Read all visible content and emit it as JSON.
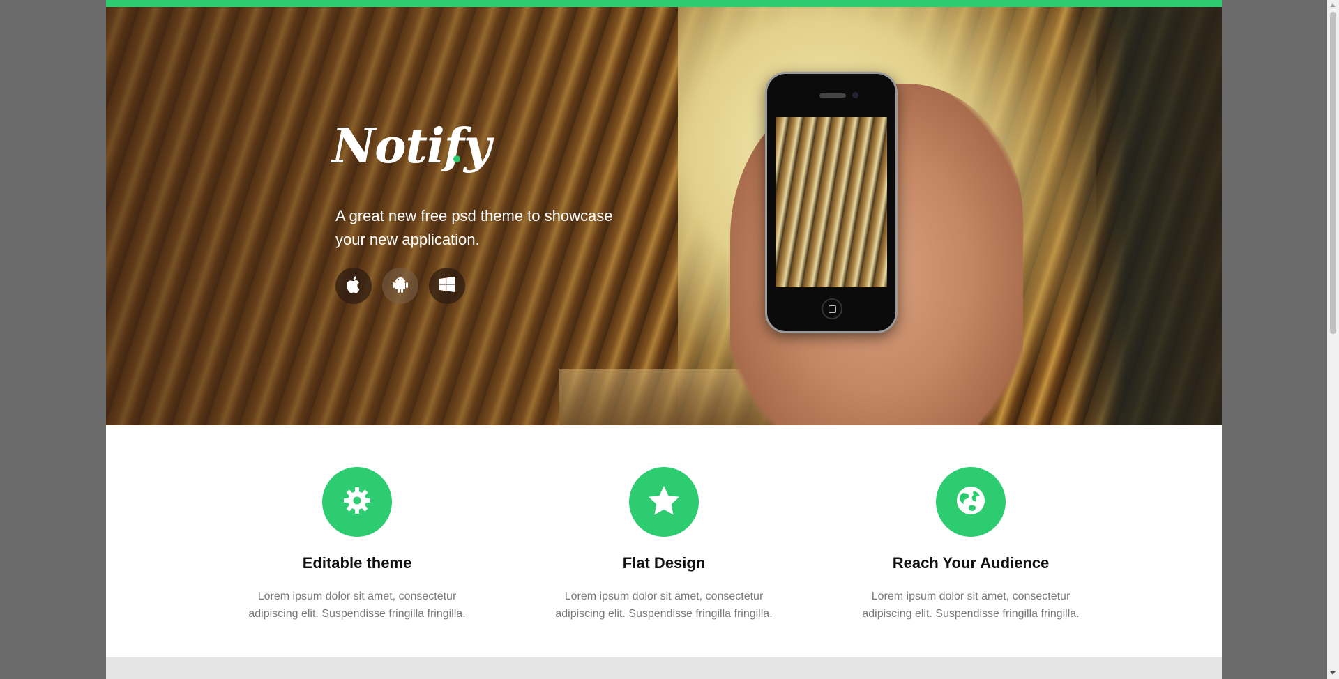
{
  "brand": {
    "name": "Notify",
    "accent_color": "#2ecc71"
  },
  "hero": {
    "tagline": "A great new free psd theme to showcase your new application.",
    "store_buttons": [
      {
        "icon": "apple-icon"
      },
      {
        "icon": "android-icon"
      },
      {
        "icon": "windows-icon"
      }
    ]
  },
  "features": [
    {
      "icon": "gear-icon",
      "title": "Editable theme",
      "text": "Lorem ipsum dolor sit amet, consectetur adipiscing elit. Suspendisse fringilla fringilla."
    },
    {
      "icon": "star-icon",
      "title": "Flat Design",
      "text": "Lorem ipsum dolor sit amet, consectetur adipiscing elit. Suspendisse fringilla fringilla."
    },
    {
      "icon": "globe-icon",
      "title": "Reach Your Audience",
      "text": "Lorem ipsum dolor sit amet, consectetur adipiscing elit. Suspendisse fringilla fringilla."
    }
  ]
}
